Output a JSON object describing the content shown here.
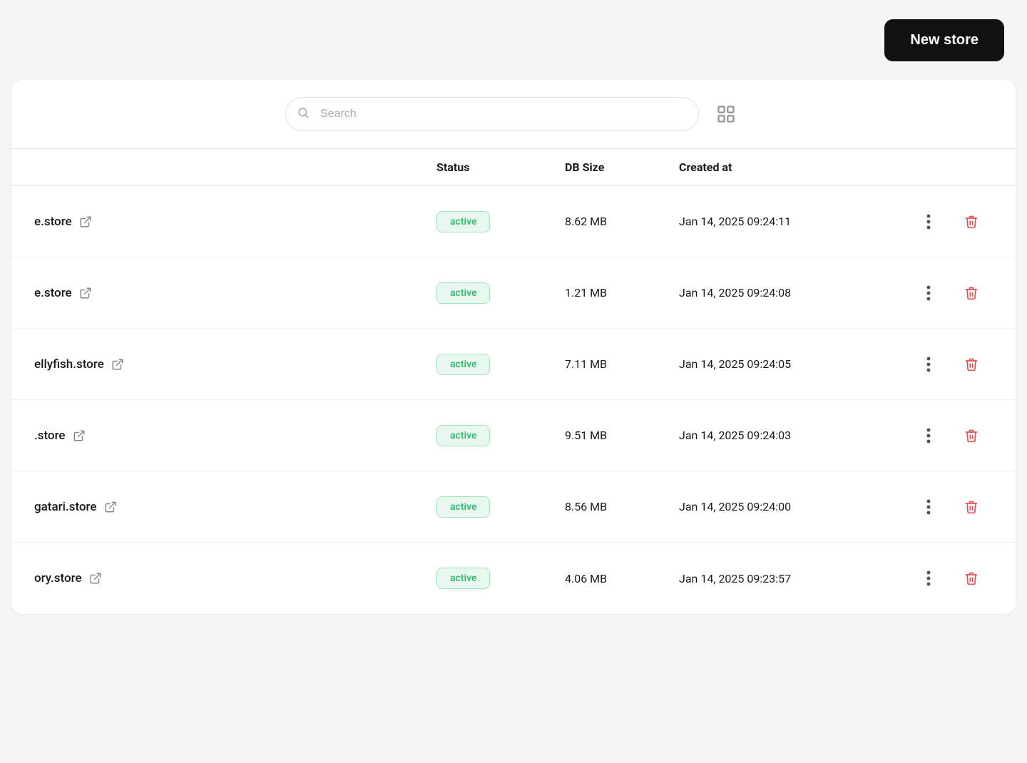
{
  "header": {
    "new_store_label": "New store"
  },
  "search": {
    "placeholder": "Search"
  },
  "table": {
    "columns": {
      "name": "",
      "status": "Status",
      "dbsize": "DB Size",
      "created": "Created at"
    },
    "rows": [
      {
        "name": "e.store",
        "status": "active",
        "dbsize": "8.62 MB",
        "created": "Jan 14, 2025 09:24:11"
      },
      {
        "name": "e.store",
        "status": "active",
        "dbsize": "1.21 MB",
        "created": "Jan 14, 2025 09:24:08"
      },
      {
        "name": "ellyfish.store",
        "status": "active",
        "dbsize": "7.11 MB",
        "created": "Jan 14, 2025 09:24:05"
      },
      {
        "name": ".store",
        "status": "active",
        "dbsize": "9.51 MB",
        "created": "Jan 14, 2025 09:24:03"
      },
      {
        "name": "gatari.store",
        "status": "active",
        "dbsize": "8.56 MB",
        "created": "Jan 14, 2025 09:24:00"
      },
      {
        "name": "ory.store",
        "status": "active",
        "dbsize": "4.06 MB",
        "created": "Jan 14, 2025 09:23:57"
      }
    ]
  },
  "colors": {
    "active_bg": "#e8f8ef",
    "active_text": "#2db76c",
    "active_border": "#a3e4c0",
    "delete_red": "#e05252",
    "more_gray": "#666666"
  }
}
